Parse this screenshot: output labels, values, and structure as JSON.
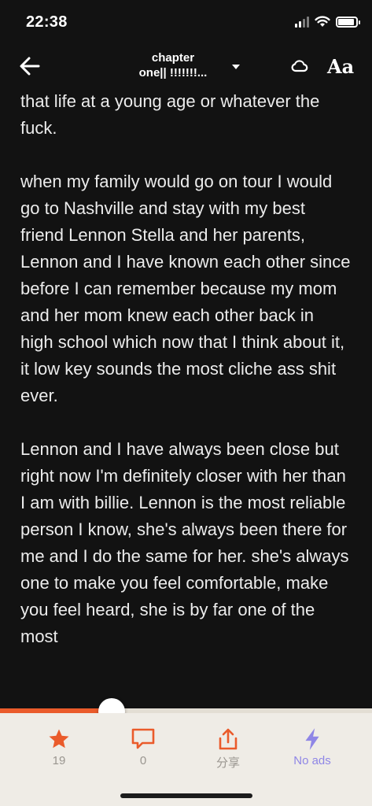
{
  "status": {
    "time": "22:38"
  },
  "header": {
    "title_line1": "chapter",
    "title_line2": "one|| !!!!!!!...",
    "font_label": "Aa"
  },
  "content": {
    "paragraphs": [
      "that life at a young age or whatever the fuck.",
      "when my family would go on tour I would go to Nashville and stay with my best friend Lennon Stella and her parents, Lennon and I have known each other since before I can remember because my mom and her mom knew each other back in high school which now that I think about it, it low key sounds the most cliche ass shit ever.",
      "Lennon and I have always been close but right now I'm definitely closer with her than I am with billie. Lennon is the most reliable person I know, she's always been there for me and I do the same for her. she's always one to make you feel comfortable, make you feel heard, she is by far one of the most"
    ]
  },
  "reading_progress": 0.3,
  "actions": {
    "vote_count": "19",
    "comment_count": "0",
    "share_label": "分享",
    "no_ads_label": "No ads"
  },
  "colors": {
    "accent": "#ea5b2b",
    "no_ads": "#8f86e6",
    "background": "#121212",
    "bottom_bar": "#efece6"
  },
  "icons": {
    "back": "arrow-left-icon",
    "caret": "caret-down-icon",
    "cloud": "cloud-icon",
    "vote": "star-icon",
    "comment": "comment-icon",
    "share": "share-icon",
    "no_ads": "lightning-icon"
  }
}
